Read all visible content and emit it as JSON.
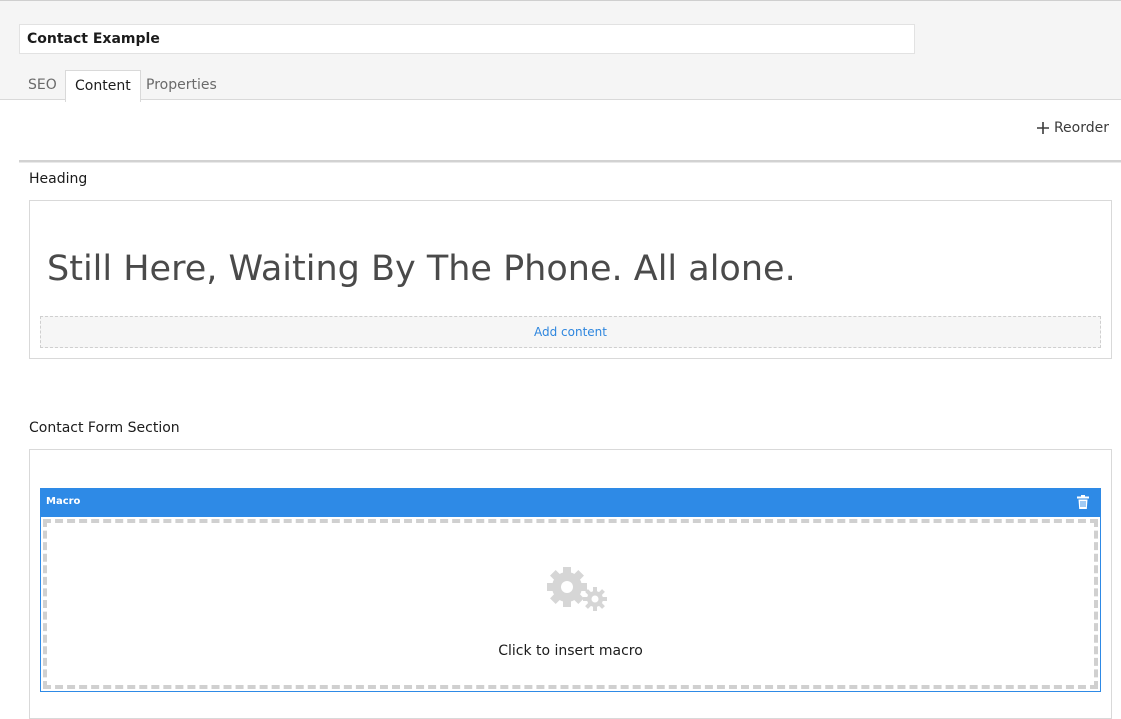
{
  "page": {
    "name_value": "Contact Example"
  },
  "tabs": [
    {
      "label": "SEO",
      "active": false
    },
    {
      "label": "Content",
      "active": true
    },
    {
      "label": "Properties",
      "active": false
    }
  ],
  "toolbar": {
    "reorder_label": "Reorder",
    "reorder_icon": "plus-move-icon"
  },
  "sections": {
    "heading": {
      "title": "Heading",
      "content_text": "Still Here, Waiting By The Phone. All alone.",
      "add_content_label": "Add content"
    },
    "contact_form": {
      "title": "Contact Form Section",
      "macro_label": "Macro",
      "macro_delete_icon": "trash-icon",
      "macro_placeholder_icon": "gears-icon",
      "macro_placeholder_text": "Click to insert macro"
    }
  },
  "colors": {
    "accent": "#2e8ae6",
    "link": "#2e86de",
    "header_bg": "#f5f5f5"
  }
}
